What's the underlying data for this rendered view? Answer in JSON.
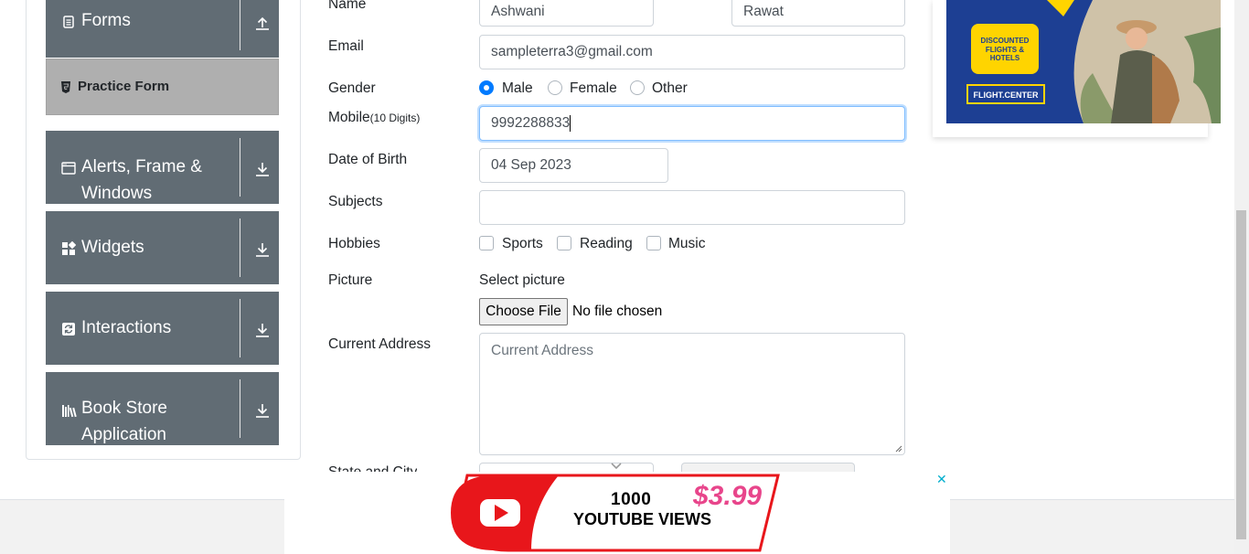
{
  "sidebar": {
    "groups": [
      {
        "label": "Forms",
        "icon": "form-icon",
        "arrow": "arrow-up-icon"
      },
      {
        "label_line1": "Alerts, Frame &",
        "label_line2": "Windows",
        "icon": "window-icon",
        "arrow": "arrow-down-icon"
      },
      {
        "label": "Widgets",
        "icon": "widgets-icon",
        "arrow": "arrow-down-icon"
      },
      {
        "label": "Interactions",
        "icon": "interactions-icon",
        "arrow": "arrow-down-icon"
      },
      {
        "label_line1": "Book Store",
        "label_line2": "Application",
        "icon": "books-icon",
        "arrow": "arrow-down-icon"
      }
    ],
    "active_item": "Practice Form"
  },
  "form": {
    "name_label": "Name",
    "first_name": "Ashwani",
    "last_name": "Rawat",
    "email_label": "Email",
    "email": "sampleterra3@gmail.com",
    "gender_label": "Gender",
    "gender_options": [
      "Male",
      "Female",
      "Other"
    ],
    "gender_selected": "Male",
    "mobile_label": "Mobile",
    "mobile_hint": "(10 Digits)",
    "mobile": "9992288833",
    "dob_label": "Date of Birth",
    "dob": "04 Sep 2023",
    "subjects_label": "Subjects",
    "hobbies_label": "Hobbies",
    "hobbies": [
      "Sports",
      "Reading",
      "Music"
    ],
    "picture_label": "Picture",
    "select_picture": "Select picture",
    "choose_file": "Choose File",
    "no_file": "No file chosen",
    "address_label": "Current Address",
    "address_placeholder": "Current Address",
    "state_city_label": "State and City"
  },
  "ads": {
    "top": {
      "line1": "DISCOUNTED",
      "line2": "FLIGHTS & HOTELS",
      "brand": "FLIGHT.CENTER"
    },
    "bottom": {
      "line1": "1000",
      "line2": "YOUTUBE VIEWS",
      "price": "$3.99",
      "close": "✕"
    }
  },
  "colors": {
    "sidebar_bg": "#616c74",
    "accent": "#007bff",
    "ad_blue": "#1d3f93",
    "ad_yellow": "#ffd400",
    "youtube_red": "#e8161b",
    "price_pink": "#e8458b"
  }
}
